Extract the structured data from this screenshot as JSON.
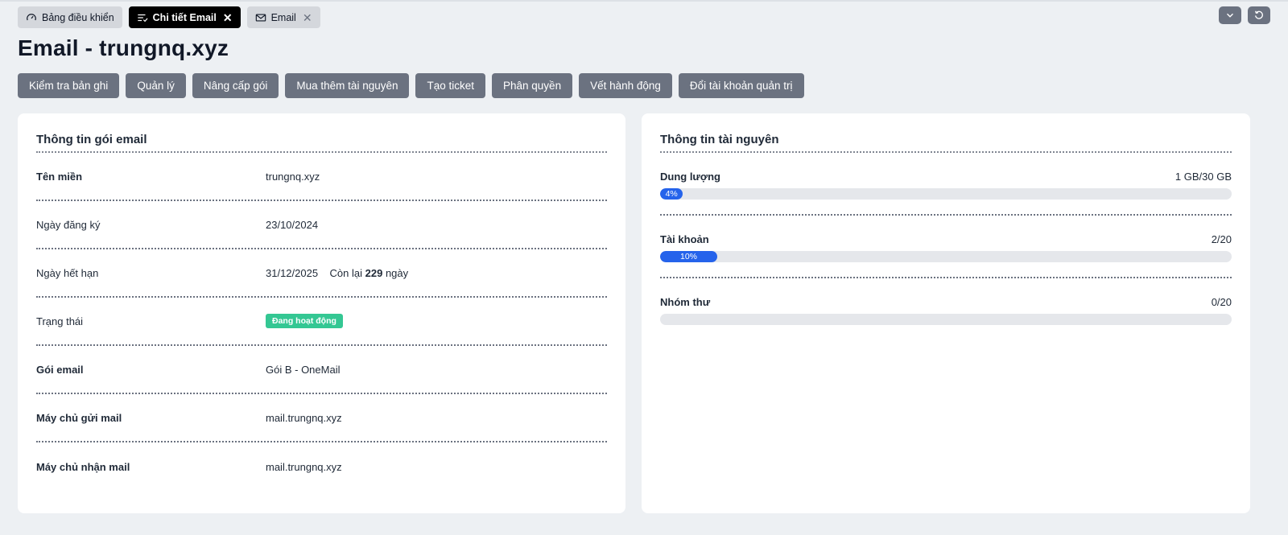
{
  "tabs": [
    {
      "label": "Bảng điều khiển",
      "icon": "dashboard-gauge-icon",
      "active": false,
      "closable": false
    },
    {
      "label": "Chi tiết Email",
      "icon": "list-check-icon",
      "active": true,
      "closable": true
    },
    {
      "label": "Email",
      "icon": "envelope-icon",
      "active": false,
      "closable": true
    }
  ],
  "page_title": "Email - trungnq.xyz",
  "actions": [
    "Kiểm tra bản ghi",
    "Quản lý",
    "Nâng cấp gói",
    "Mua thêm tài nguyên",
    "Tạo ticket",
    "Phân quyền",
    "Vết hành động",
    "Đổi tài khoản quản trị"
  ],
  "package_info": {
    "title": "Thông tin gói email",
    "rows": [
      {
        "label": "Tên miền",
        "value": "trungnq.xyz"
      },
      {
        "label": "Ngày đăng ký",
        "value": "23/10/2024"
      },
      {
        "label": "Ngày hết hạn",
        "value": "31/12/2025",
        "remaining_prefix": "Còn lại",
        "remaining_days": "229",
        "remaining_suffix": "ngày"
      },
      {
        "label": "Trạng thái",
        "badge": "Đang hoạt động"
      },
      {
        "label": "Gói email",
        "value": "Gói B - OneMail"
      },
      {
        "label": "Máy chủ gửi mail",
        "value": "mail.trungnq.xyz"
      },
      {
        "label": "Máy chủ nhận mail",
        "value": "mail.trungnq.xyz"
      }
    ]
  },
  "resource_info": {
    "title": "Thông tin tài nguyên",
    "items": [
      {
        "label": "Dung lượng",
        "value": "1 GB/30 GB",
        "percent_label": "4%",
        "percent": 4
      },
      {
        "label": "Tài khoản",
        "value": "2/20",
        "percent_label": "10%",
        "percent": 10
      },
      {
        "label": "Nhóm thư",
        "value": "0/20",
        "percent_label": "",
        "percent": 0
      }
    ]
  },
  "colors": {
    "active_tab": "#000000",
    "button": "#6b7280",
    "badge": "#34c793",
    "progress": "#2563eb"
  }
}
